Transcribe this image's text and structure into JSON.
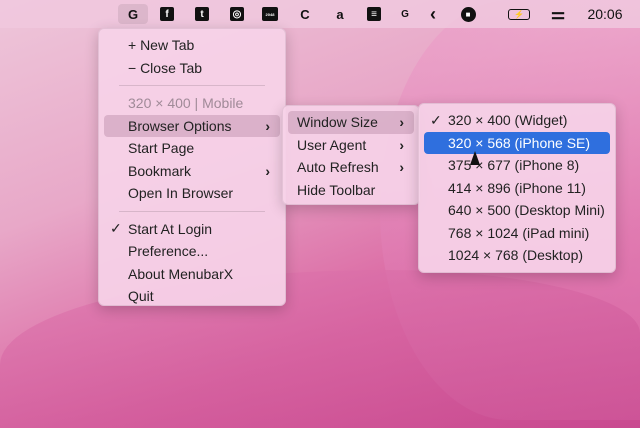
{
  "menubar": {
    "icons": [
      {
        "name": "google-icon",
        "glyph": "G"
      },
      {
        "name": "facebook-icon",
        "glyph": "f"
      },
      {
        "name": "twitter-icon",
        "glyph": "t"
      },
      {
        "name": "instagram-icon",
        "glyph": "◎"
      },
      {
        "name": "2048-icon",
        "glyph": "2048"
      },
      {
        "name": "chrome-c-icon",
        "glyph": "C"
      },
      {
        "name": "amazon-icon",
        "glyph": "a"
      },
      {
        "name": "spotify-icon",
        "glyph": "≡"
      },
      {
        "name": "translate-icon",
        "glyph": "G"
      },
      {
        "name": "chevron-left-icon",
        "glyph": "‹"
      },
      {
        "name": "stop-icon",
        "glyph": "■"
      },
      {
        "name": "battery-charging-icon",
        "glyph": "⚡"
      },
      {
        "name": "control-center-icon",
        "glyph": "⚌"
      }
    ],
    "time": "20:06"
  },
  "main_menu": {
    "new_tab": "+ New Tab",
    "close_tab": "− Close Tab",
    "size_info": "320 × 400 | Mobile",
    "browser_options": "Browser Options",
    "start_page": "Start Page",
    "bookmark": "Bookmark",
    "open_in_browser": "Open In Browser",
    "start_at_login": "Start At Login",
    "preference": "Preference...",
    "about": "About MenubarX",
    "quit": "Quit",
    "check": "✓",
    "arrow": "›"
  },
  "browser_options_menu": {
    "window_size": "Window Size",
    "user_agent": "User Agent",
    "auto_refresh": "Auto Refresh",
    "hide_toolbar": "Hide Toolbar"
  },
  "window_size_menu": {
    "items": [
      "320 × 400 (Widget)",
      "320 × 568 (iPhone SE)",
      "375 × 677 (iPhone 8)",
      "414 × 896 (iPhone 11)",
      "640 × 500 (Desktop Mini)",
      "768 × 1024 (iPad mini)",
      "1024 × 768 (Desktop)"
    ],
    "checked_index": 0,
    "highlighted_index": 1
  },
  "colors": {
    "highlight": "#2f6fde"
  }
}
